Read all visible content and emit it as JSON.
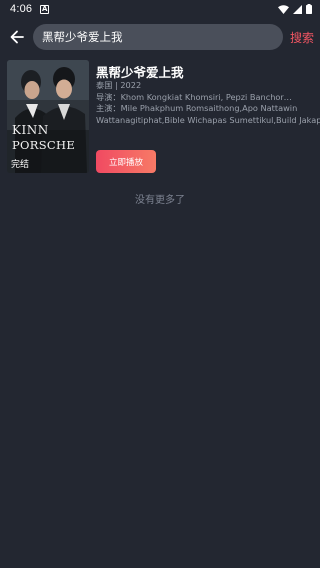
{
  "status_bar": {
    "time": "4:06",
    "notification_letter": "A"
  },
  "search": {
    "query": "黑帮少爷爱上我",
    "submit_label": "搜索"
  },
  "result": {
    "title": "黑帮少爷爱上我",
    "meta": "泰国 | 2022",
    "director": "导演：Khom Kongkiat Khomsiri, Pepzi Banchorn ...",
    "cast_line1": "主演：Mile Phakphum Romsaithong,Apo Nattawin",
    "cast_line2": "Wattanagitiphat,Bible Wichapas Sumettikul,Build Jakapan",
    "badge": "完结",
    "poster_text_1": "KINN",
    "poster_text_2": "PORSCHE",
    "play_label": "立即播放"
  },
  "footer": {
    "no_more": "没有更多了"
  },
  "colors": {
    "background": "#232731",
    "accent": "#f15562",
    "search_box": "#4a4f5a"
  }
}
